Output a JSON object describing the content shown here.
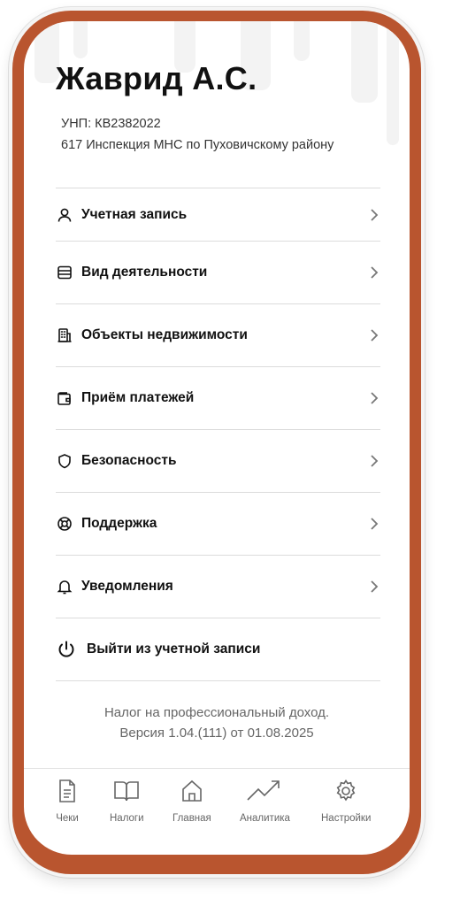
{
  "profile": {
    "name": "Жаврид А.С.",
    "unp": "УНП: КВ2382022",
    "inspection": "617 Инспекция МНС по Пуховичскому району"
  },
  "menu": {
    "items": [
      {
        "label": "Учетная запись",
        "icon": "user-icon"
      },
      {
        "label": "Вид деятельности",
        "icon": "list-icon"
      },
      {
        "label": "Объекты недвижимости",
        "icon": "building-icon"
      },
      {
        "label": "Приём платежей",
        "icon": "wallet-icon"
      },
      {
        "label": "Безопасность",
        "icon": "shield-icon"
      },
      {
        "label": "Поддержка",
        "icon": "lifebuoy-icon"
      },
      {
        "label": "Уведомления",
        "icon": "bell-icon"
      }
    ],
    "logout_label": "Выйти из учетной записи"
  },
  "footer": {
    "line1": "Налог на профессиональный доход.",
    "line2": "Версия 1.04.(111) от 01.08.2025"
  },
  "tabbar": {
    "tabs": [
      {
        "label": "Чеки",
        "icon": "receipt-icon"
      },
      {
        "label": "Налоги",
        "icon": "book-icon"
      },
      {
        "label": "Главная",
        "icon": "home-icon"
      },
      {
        "label": "Аналитика",
        "icon": "trend-icon"
      },
      {
        "label": "Настройки",
        "icon": "gear-icon"
      }
    ]
  },
  "colors": {
    "frame": "#b9552f",
    "text": "#111111",
    "muted": "#666666"
  }
}
